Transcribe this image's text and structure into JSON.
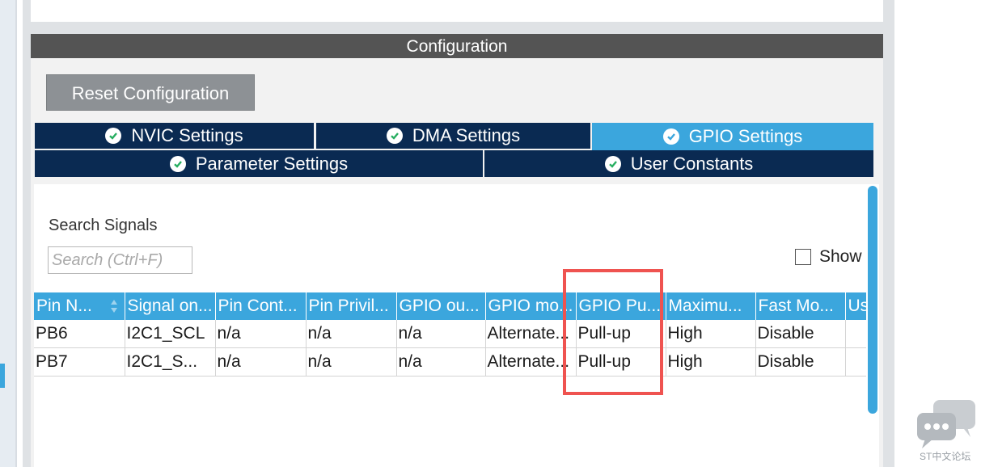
{
  "configuration": {
    "header_title": "Configuration",
    "reset_button_label": "Reset Configuration"
  },
  "tabs": {
    "row1": [
      {
        "label": "NVIC Settings",
        "active": false
      },
      {
        "label": "DMA Settings",
        "active": false
      },
      {
        "label": "GPIO Settings",
        "active": true
      }
    ],
    "row2": [
      {
        "label": "Parameter Settings",
        "active": false
      },
      {
        "label": "User Constants",
        "active": false
      }
    ]
  },
  "search": {
    "label": "Search Signals",
    "placeholder": "Search (Ctrl+F)",
    "value": ""
  },
  "show_option": {
    "label": "Show",
    "checked": false
  },
  "table": {
    "columns": [
      "Pin N...",
      "Signal on...",
      "Pin Cont...",
      "Pin Privil...",
      "GPIO ou...",
      "GPIO mo...",
      "GPIO Pu...",
      "Maximu...",
      "Fast Mo...",
      "Us"
    ],
    "rows": [
      [
        "PB6",
        "I2C1_SCL",
        "n/a",
        "n/a",
        "n/a",
        "Alternate...",
        "Pull-up",
        "High",
        "Disable",
        ""
      ],
      [
        "PB7",
        "I2C1_S...",
        "n/a",
        "n/a",
        "n/a",
        "Alternate...",
        "Pull-up",
        "High",
        "Disable",
        ""
      ]
    ]
  },
  "watermark": {
    "text": "ST中文论坛"
  },
  "colors": {
    "accent": "#3ba6dd",
    "tab_dark": "#0a2a52",
    "header_gray": "#545454",
    "highlight_red": "#ef5350"
  }
}
